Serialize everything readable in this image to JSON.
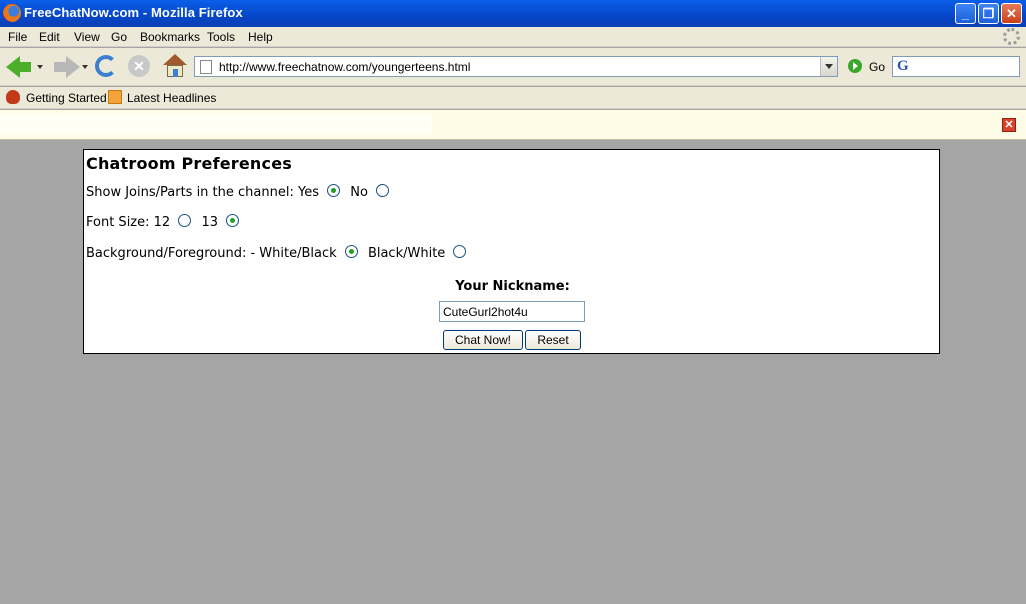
{
  "window": {
    "title": "FreeChatNow.com - Mozilla Firefox"
  },
  "menu": [
    "File",
    "Edit",
    "View",
    "Go",
    "Bookmarks",
    "Tools",
    "Help"
  ],
  "nav": {
    "url": "http://www.freechatnow.com/youngerteens.html",
    "go_label": "Go",
    "search_engine": "G"
  },
  "bookmarks": [
    "Getting Started",
    "Latest Headlines"
  ],
  "prefs": {
    "heading": "Chatroom Preferences",
    "joins_label": "Show Joins/Parts in the channel:",
    "joins_yes": "Yes",
    "joins_no": "No",
    "joins_selected": "Yes",
    "font_label": "Font Size:",
    "font_12": "12",
    "font_13": "13",
    "font_selected": "13",
    "bg_label": "Background/Foreground: - White/Black",
    "bg_alt": "Black/White",
    "bg_selected": "White/Black",
    "nick_label": "Your Nickname:",
    "nick_value": "CuteGurl2hot4u",
    "chat_button": "Chat Now!",
    "reset_button": "Reset"
  },
  "colors": {
    "titlebar": "#0646c8",
    "chrome": "#ece9d8",
    "page_bg": "#a5a5a5",
    "radio_dot": "#21a121"
  }
}
